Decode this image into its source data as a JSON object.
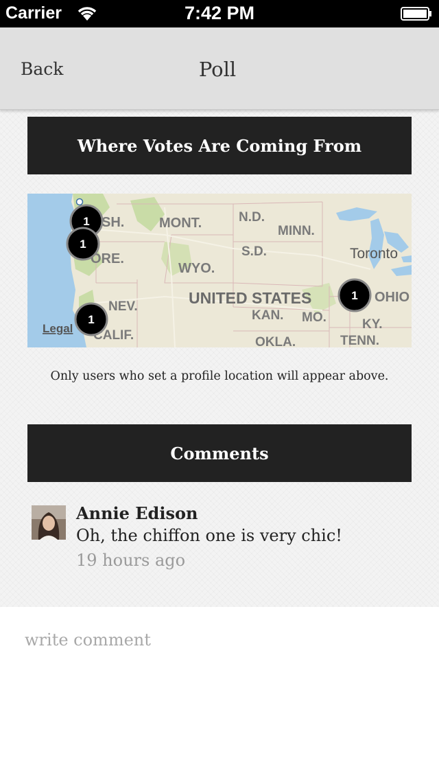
{
  "status_bar": {
    "carrier": "Carrier",
    "time": "7:42 PM",
    "wifi_icon": "wifi-icon",
    "battery_icon": "battery-icon"
  },
  "nav": {
    "back_label": "Back",
    "title": "Poll"
  },
  "votes_section": {
    "title": "Where Votes Are Coming From",
    "map": {
      "region_labels": [
        "MONT.",
        "N.D.",
        "MINN.",
        "S.D.",
        "WYO.",
        "UNITED STATES",
        "NEV.",
        "KAN.",
        "MO.",
        "KY.",
        "OKLA.",
        "TENN.",
        "SH.",
        "ORE.",
        "CALIF.",
        "Toronto",
        "OHIO"
      ],
      "legal_label": "Legal",
      "pins": [
        {
          "count": "1",
          "location": "Washington"
        },
        {
          "count": "1",
          "location": "Oregon"
        },
        {
          "count": "1",
          "location": "California"
        },
        {
          "count": "1",
          "location": "Ohio"
        }
      ],
      "colors": {
        "water": "#a3cbe9",
        "land": "#ece8d7",
        "forest": "#c9dca7",
        "pin": "#000000"
      }
    },
    "note": "Only users who set a profile location will appear above."
  },
  "comments_section": {
    "title": "Comments",
    "comments": [
      {
        "author": "Annie Edison",
        "text": "Oh, the chiffon one is very chic!",
        "time": "19 hours ago"
      }
    ]
  },
  "composer": {
    "placeholder": "write comment"
  }
}
